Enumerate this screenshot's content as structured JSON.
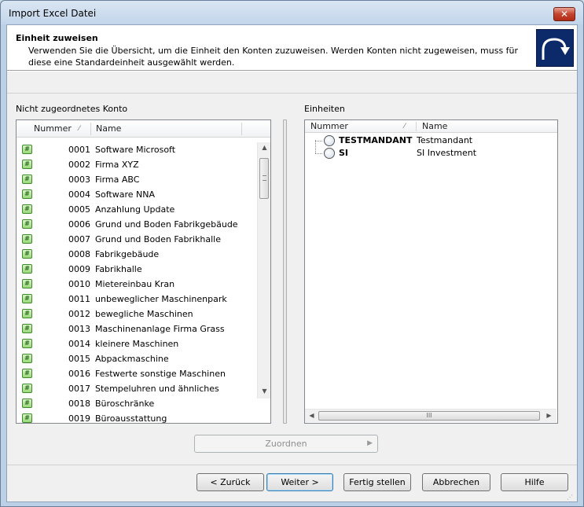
{
  "window": {
    "title": "Import Excel Datei",
    "close_label": "✕"
  },
  "header": {
    "title": "Einheit zuweisen",
    "description": "Verwenden Sie die Übersicht, um die Einheit den Konten zuzuweisen. Werden Konten nicht zugeweisen, muss für diese eine Standardeinheit ausgewählt werden."
  },
  "accounts_panel": {
    "label": "Nicht zugeordnetes Konto",
    "col_number": "Nummer",
    "col_name": "Name",
    "icon_glyph": "#",
    "rows": [
      {
        "number": "0001",
        "name": "Software Microsoft"
      },
      {
        "number": "0002",
        "name": "Firma XYZ"
      },
      {
        "number": "0003",
        "name": "Firma ABC"
      },
      {
        "number": "0004",
        "name": "Software NNA"
      },
      {
        "number": "0005",
        "name": "Anzahlung Update"
      },
      {
        "number": "0006",
        "name": "Grund und Boden Fabrikgebäude"
      },
      {
        "number": "0007",
        "name": "Grund und Boden Fabrikhalle"
      },
      {
        "number": "0008",
        "name": "Fabrikgebäude"
      },
      {
        "number": "0009",
        "name": "Fabrikhalle"
      },
      {
        "number": "0010",
        "name": "Mietereinbau Kran"
      },
      {
        "number": "0011",
        "name": "unbeweglicher Maschinenpark"
      },
      {
        "number": "0012",
        "name": "bewegliche Maschinen"
      },
      {
        "number": "0013",
        "name": "Maschinenanlage Firma Grass"
      },
      {
        "number": "0014",
        "name": "kleinere Maschinen"
      },
      {
        "number": "0015",
        "name": "Abpackmaschine"
      },
      {
        "number": "0016",
        "name": "Festwerte sonstige Maschinen"
      },
      {
        "number": "0017",
        "name": "Stempeluhren und ähnliches"
      },
      {
        "number": "0018",
        "name": "Büroschränke"
      },
      {
        "number": "0019",
        "name": "Büroausstattung"
      }
    ]
  },
  "units_panel": {
    "label": "Einheiten",
    "col_number": "Nummer",
    "col_name": "Name",
    "nodes": [
      {
        "number": "TESTMANDANT",
        "name": "Testmandant"
      },
      {
        "number": "SI",
        "name": "SI Investment"
      }
    ]
  },
  "scroll_glyphs": {
    "up": "▲",
    "down": "▼",
    "left": "◀",
    "right": "▶",
    "grip": "III"
  },
  "assign_button": {
    "label": "Zuordnen",
    "arrow": "▶"
  },
  "footer": {
    "back": "< Zurück",
    "next": "Weiter >",
    "finish": "Fertig stellen",
    "cancel": "Abbrechen",
    "help": "Hilfe"
  },
  "colors": {
    "header_logo": "#0c2a6a",
    "account_icon": "#9bd87b"
  }
}
